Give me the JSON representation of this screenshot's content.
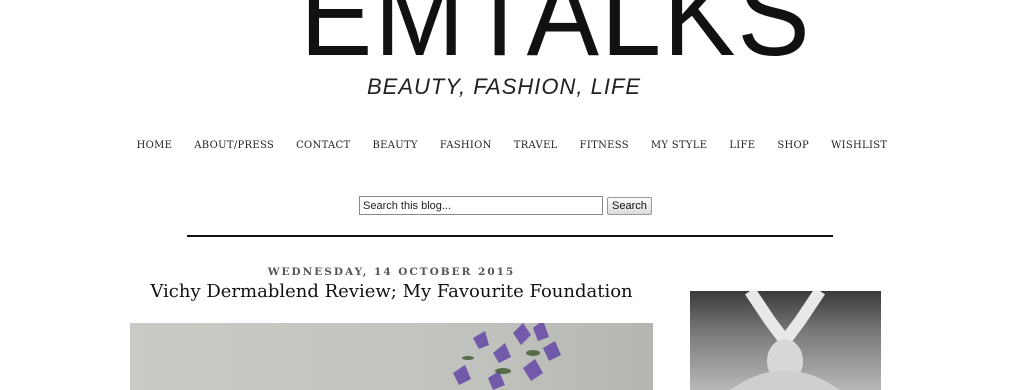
{
  "header": {
    "logo": "EMTALKS",
    "tagline": "BEAUTY, FASHION, LIFE"
  },
  "nav": {
    "items": [
      "HOME",
      "ABOUT/PRESS",
      "CONTACT",
      "BEAUTY",
      "FASHION",
      "TRAVEL",
      "FITNESS",
      "MY STYLE",
      "LIFE",
      "SHOP",
      "WISHLIST"
    ]
  },
  "search": {
    "placeholder": "Search this blog...",
    "button_label": "Search"
  },
  "post": {
    "date": "WEDNESDAY, 14 OCTOBER 2015",
    "title": "Vichy Dermablend Review; My Favourite Foundation"
  },
  "colors": {
    "text": "#222222",
    "divider": "#111111"
  }
}
